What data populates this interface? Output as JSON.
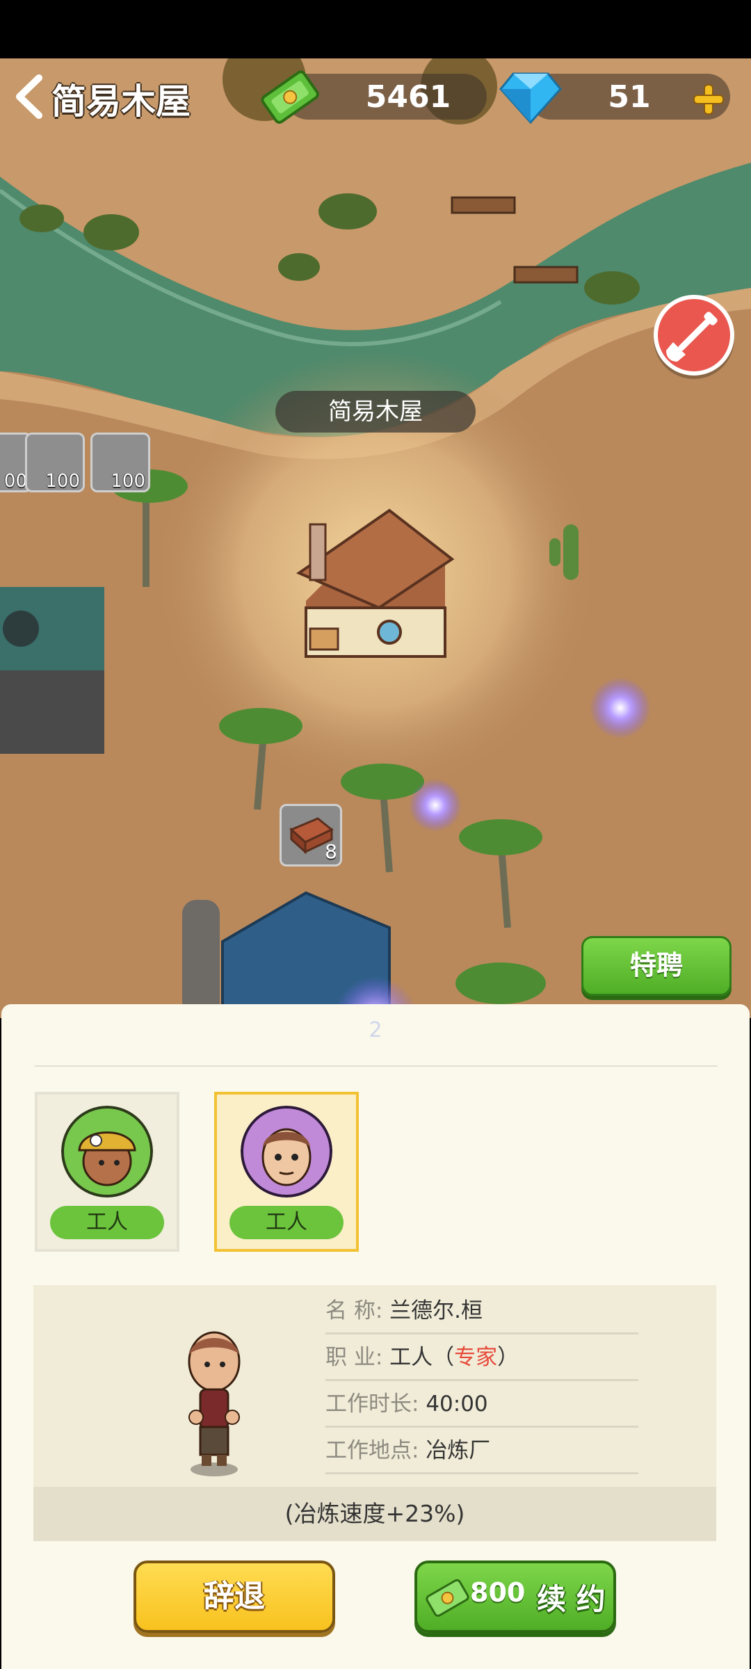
{
  "header": {
    "title": "简易木屋",
    "cash": "5461",
    "gems": "51",
    "icons": {
      "back": "back-arrow-icon",
      "cash": "cash-stack-icon",
      "gem": "diamond-icon",
      "plus": "plus-icon"
    }
  },
  "map": {
    "building_label": "简易木屋",
    "resource_tiles": [
      "00",
      "100",
      "100"
    ],
    "brick_count": "8",
    "special_hire": "特聘",
    "shovel_icon": "shovel-icon"
  },
  "panel": {
    "page_number": "2",
    "workers": [
      {
        "role": "工人",
        "avatar": "miner-avatar-icon",
        "selected": false
      },
      {
        "role": "工人",
        "avatar": "worker-avatar-icon",
        "selected": true
      }
    ],
    "details": {
      "name_label": "名 称:",
      "name_value": "兰德尔.桓",
      "job_label": "职 业:",
      "job_value": "工人（",
      "job_highlight": "专家",
      "job_close": "）",
      "duration_label": "工作时长:",
      "duration_value": "40:00",
      "location_label": "工作地点:",
      "location_value": "冶炼厂",
      "bonus": "(冶炼速度+23%)"
    },
    "dismiss": "辞退",
    "renew_cost": "800",
    "renew_label": "续 约"
  },
  "colors": {
    "accent_green": "#5ab82e",
    "accent_yellow": "#f8c21f",
    "highlight_red": "#e8493a"
  }
}
